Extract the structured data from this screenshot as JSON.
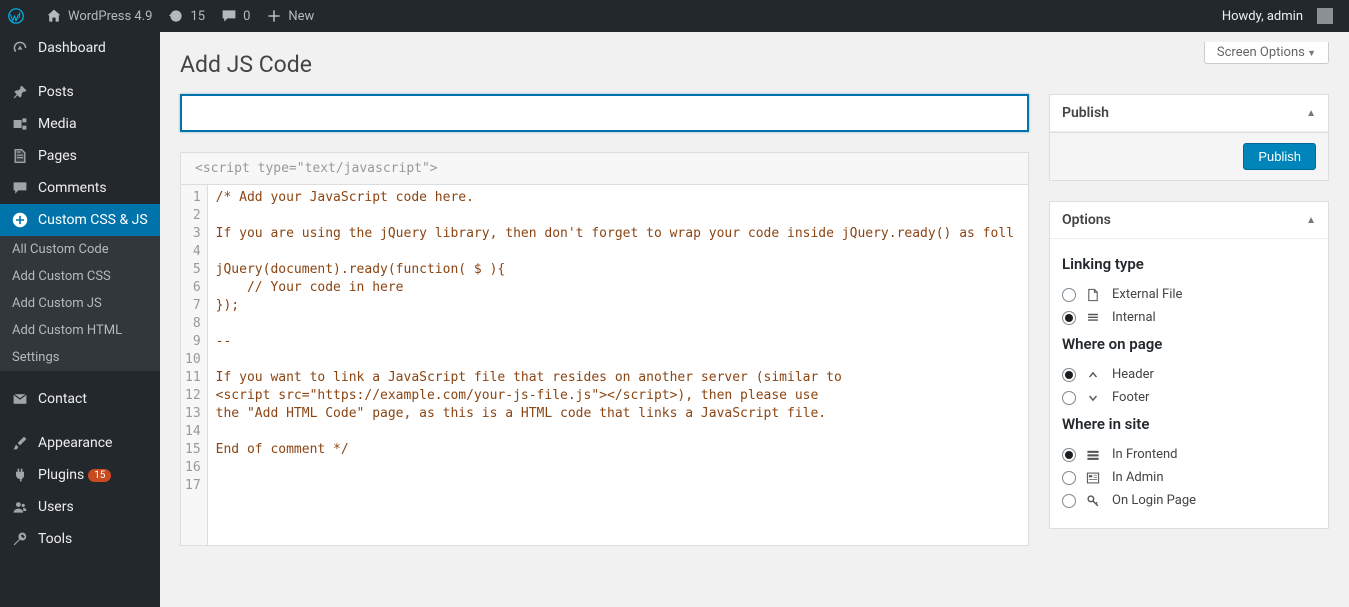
{
  "adminbar": {
    "site_title": "WordPress 4.9",
    "updates": "15",
    "comments": "0",
    "new_label": "New",
    "howdy": "Howdy, admin"
  },
  "sidebar": {
    "items": [
      {
        "label": "Dashboard",
        "icon": "dashboard"
      },
      {
        "label": "Posts",
        "icon": "pin"
      },
      {
        "label": "Media",
        "icon": "media"
      },
      {
        "label": "Pages",
        "icon": "pages"
      },
      {
        "label": "Comments",
        "icon": "comment"
      },
      {
        "label": "Custom CSS & JS",
        "icon": "plus-circle",
        "current": true
      },
      {
        "label": "Contact",
        "icon": "mail"
      },
      {
        "label": "Appearance",
        "icon": "brush"
      },
      {
        "label": "Plugins",
        "icon": "plug",
        "badge": "15"
      },
      {
        "label": "Users",
        "icon": "users"
      },
      {
        "label": "Tools",
        "icon": "tools"
      }
    ],
    "submenu": [
      {
        "label": "All Custom Code"
      },
      {
        "label": "Add Custom CSS"
      },
      {
        "label": "Add Custom JS"
      },
      {
        "label": "Add Custom HTML"
      },
      {
        "label": "Settings"
      }
    ]
  },
  "page": {
    "screen_options": "Screen Options",
    "title": "Add JS Code",
    "title_input_value": ""
  },
  "editor": {
    "header": "<script type=\"text/javascript\">",
    "lines": [
      "/* Add your JavaScript code here.",
      "",
      "If you are using the jQuery library, then don't forget to wrap your code inside jQuery.ready() as foll",
      "",
      "jQuery(document).ready(function( $ ){",
      "    // Your code in here",
      "});",
      "",
      "--",
      "",
      "If you want to link a JavaScript file that resides on another server (similar to",
      "<script src=\"https://example.com/your-js-file.js\"></script>), then please use",
      "the \"Add HTML Code\" page, as this is a HTML code that links a JavaScript file.",
      "",
      "End of comment */",
      "",
      ""
    ]
  },
  "publish_box": {
    "title": "Publish",
    "button": "Publish"
  },
  "options_box": {
    "title": "Options",
    "sections": {
      "linking": {
        "heading": "Linking type",
        "opts": [
          {
            "label": "External File",
            "checked": false,
            "icon": "file"
          },
          {
            "label": "Internal",
            "checked": true,
            "icon": "internal"
          }
        ]
      },
      "where_page": {
        "heading": "Where on page",
        "opts": [
          {
            "label": "Header",
            "checked": true,
            "icon": "chev-up"
          },
          {
            "label": "Footer",
            "checked": false,
            "icon": "chev-down"
          }
        ]
      },
      "where_site": {
        "heading": "Where in site",
        "opts": [
          {
            "label": "In Frontend",
            "checked": true,
            "icon": "frontend"
          },
          {
            "label": "In Admin",
            "checked": false,
            "icon": "admin"
          },
          {
            "label": "On Login Page",
            "checked": false,
            "icon": "key"
          }
        ]
      }
    }
  }
}
